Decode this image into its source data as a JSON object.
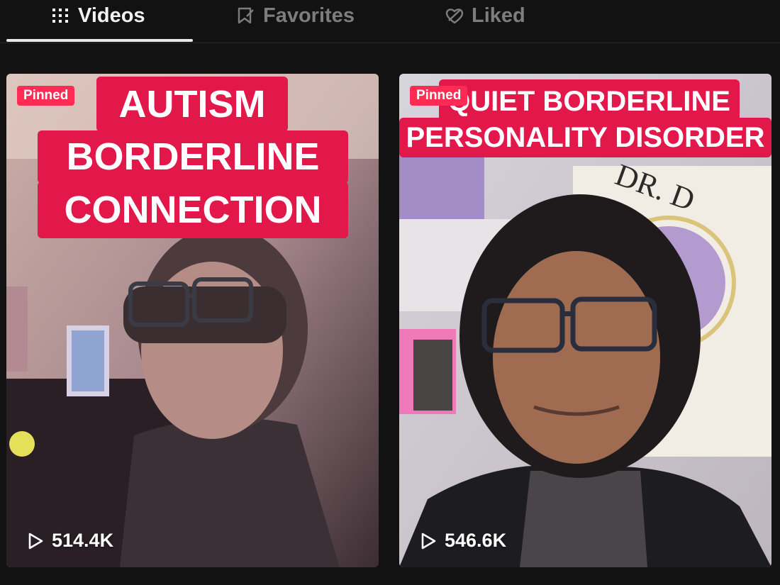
{
  "tabs": [
    {
      "label": "Videos",
      "icon": "grid-icon",
      "active": true
    },
    {
      "label": "Favorites",
      "icon": "bookmark-icon",
      "active": false
    },
    {
      "label": "Liked",
      "icon": "heart-icon",
      "active": false
    }
  ],
  "videos": [
    {
      "pinned_label": "Pinned",
      "caption_lines": [
        "AUTISM",
        "BORDERLINE",
        "CONNECTION"
      ],
      "views": "514.4K"
    },
    {
      "pinned_label": "Pinned",
      "caption_lines": [
        "QUIET BORDERLINE",
        "PERSONALITY DISORDER"
      ],
      "views": "546.6K"
    }
  ],
  "colors": {
    "background": "#121212",
    "pinned_badge": "#fe2c55",
    "caption_bg": "#e2174a",
    "active_tab": "#f2f2f2",
    "inactive_tab": "#7d7d7d"
  }
}
